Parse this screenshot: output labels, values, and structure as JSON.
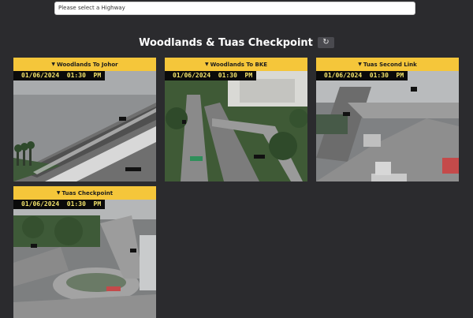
{
  "highway_select": {
    "placeholder": "Please select a Highway"
  },
  "page": {
    "title": "Woodlands & Tuas Checkpoint"
  },
  "icons": {
    "refresh": "refresh-icon",
    "caret": "caret-down-icon"
  },
  "colors": {
    "background": "#2b2b2e",
    "accent": "#f5c63a",
    "timestamp_text": "#f2e26b"
  },
  "cameras": [
    {
      "name": "Woodlands To Johor",
      "timestamp": "01/06/2024  01:30  PM"
    },
    {
      "name": "Woodlands To BKE",
      "timestamp": "01/06/2024  01:30  PM"
    },
    {
      "name": "Tuas Second Link",
      "timestamp": "01/06/2024  01:30  PM"
    },
    {
      "name": "Tuas Checkpoint",
      "timestamp": "01/06/2024  01:30  PM"
    }
  ]
}
